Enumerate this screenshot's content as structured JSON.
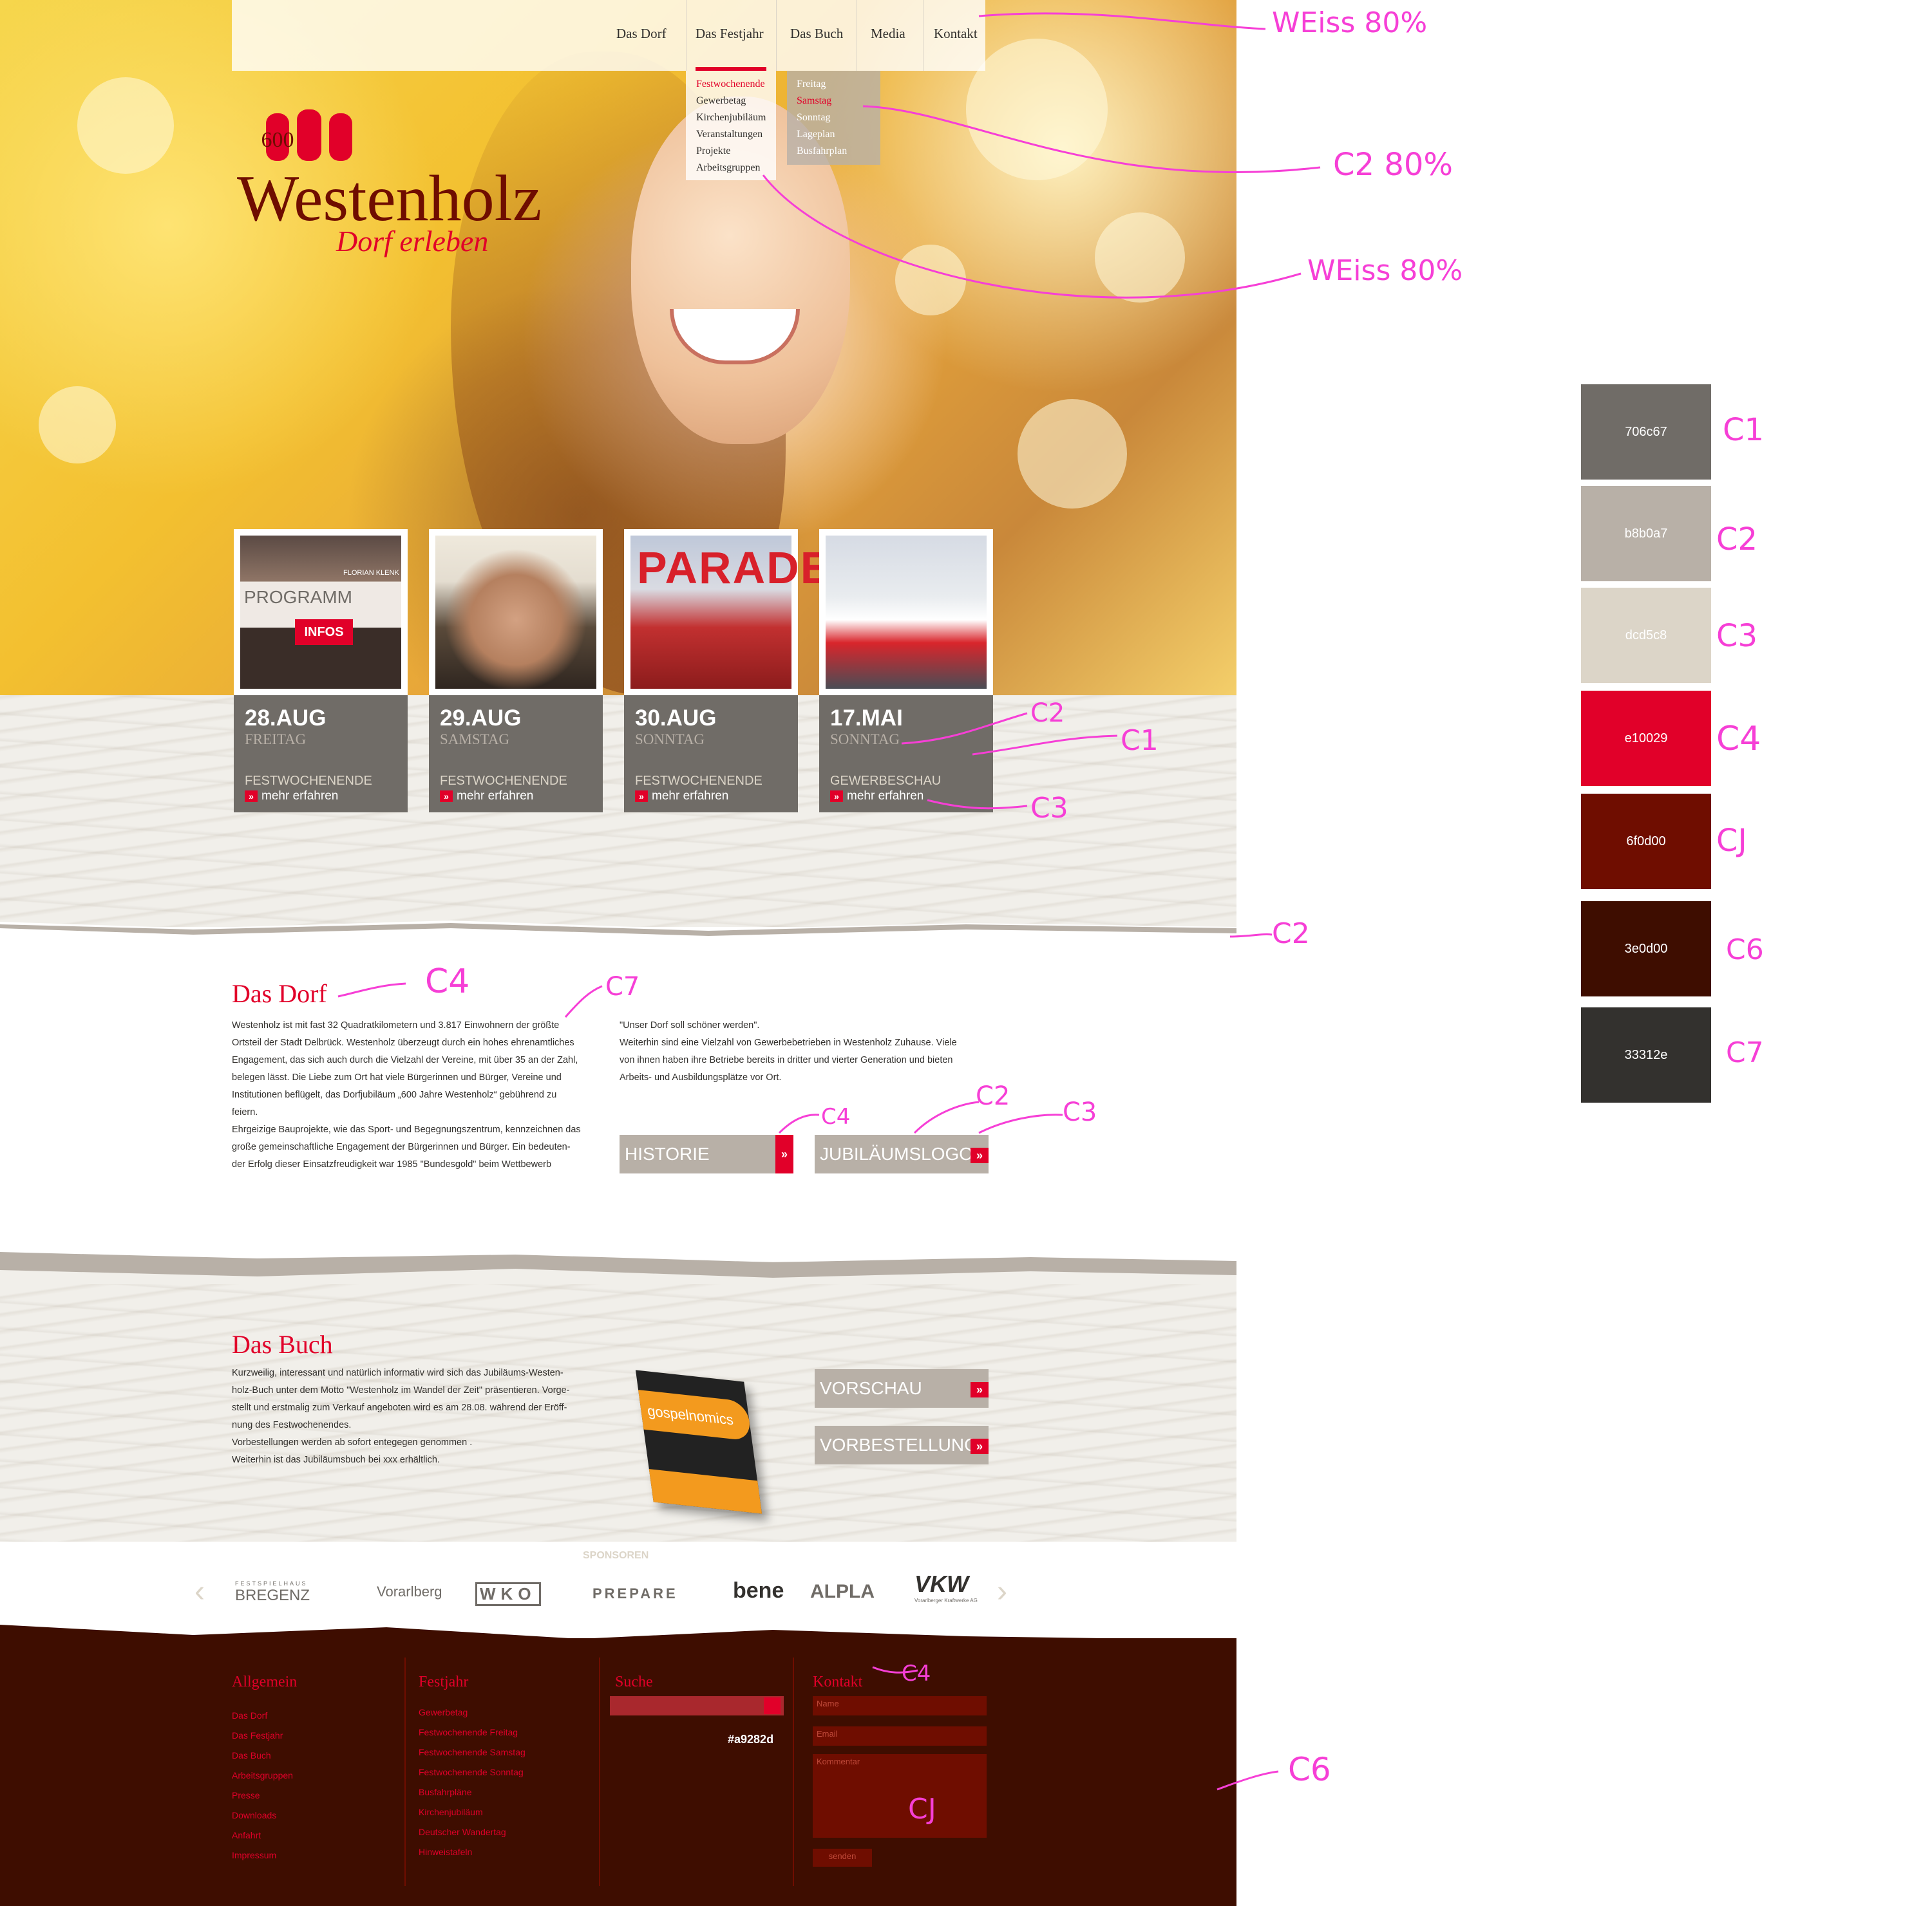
{
  "colors": {
    "c1": "#706c67",
    "c2": "#b8b0a7",
    "c3": "#dcd5c8",
    "c4": "#e10029",
    "c5": "#6f0d00",
    "c6": "#3e0d00",
    "c7": "#33312e",
    "search_field": "#a9282d"
  },
  "nav": {
    "items": [
      "Das Dorf",
      "Das Festjahr",
      "Das Buch",
      "Media",
      "Kontakt"
    ],
    "active": "Das Festjahr",
    "submenu_festjahr": [
      "Festwochenende",
      "Gewerbetag",
      "Kirchenjubiläum",
      "Veranstaltungen",
      "Projekte",
      "Arbeitsgruppen"
    ],
    "submenu_festwochenende": [
      "Freitag",
      "Samstag",
      "Sonntag",
      "Lageplan",
      "Busfahrplan"
    ]
  },
  "logo": {
    "number": "600",
    "title": "Westenholz",
    "subtitle": "Dorf erleben"
  },
  "tiles": [
    {
      "date": "28.AUG",
      "day": "FREITAG",
      "type": "FESTWOCHENENDE",
      "more": "mehr erfahren",
      "programm": "PROGRAMM",
      "infos": "INFOS",
      "book_author": "FLORIAN KLENK"
    },
    {
      "date": "29.AUG",
      "day": "SAMSTAG",
      "type": "FESTWOCHENENDE",
      "more": "mehr erfahren"
    },
    {
      "date": "30.AUG",
      "day": "SONNTAG",
      "type": "FESTWOCHENENDE",
      "more": "mehr erfahren",
      "parade_text": "PARADE"
    },
    {
      "date": "17.MAI",
      "day": "SONNTAG",
      "type": "GEWERBESCHAU",
      "more": "mehr erfahren"
    }
  ],
  "dorf": {
    "title": "Das Dorf",
    "col1_lines": [
      "Westenholz ist mit fast 32 Quadratkilometern und 3.817 Einwohnern der größte",
      "Ortsteil der Stadt Delbrück. Westenholz überzeugt durch ein hohes ehrenamtliches",
      "Engagement, das sich auch durch die Vielzahl der Vereine, mit über 35 an der Zahl,",
      "belegen lässt. Die Liebe zum Ort hat viele Bürgerinnen und Bürger, Vereine und",
      "Institutionen beflügelt, das Dorfjubiläum „600 Jahre Westenholz“ gebührend zu",
      "feiern.",
      "Ehrgeizige Bauprojekte, wie das Sport- und Begegnungszentrum, kennzeichnen das",
      "große gemeinschaftliche Engagement der Bürgerinnen und Bürger. Ein bedeuten-",
      "der Erfolg dieser Einsatzfreudigkeit war 1985 \"Bundesgold\" beim Wettbewerb"
    ],
    "col2_lines": [
      "\"Unser Dorf soll schöner werden\".",
      "Weiterhin sind eine Vielzahl von Gewerbebetrieben in Westenholz Zuhause. Viele",
      "von ihnen haben ihre Betriebe bereits in dritter und vierter Generation und bieten",
      "Arbeits- und Ausbildungsplätze vor Ort."
    ],
    "btn_historie": "HISTORIE",
    "btn_logo": "JUBILÄUMSLOGO"
  },
  "buch": {
    "title": "Das Buch",
    "lines": [
      "Kurzweilig, interessant und natürlich informativ wird sich das Jubiläums-Westen-",
      "holz-Buch unter dem Motto \"Westenholz im Wandel der Zeit\" präsentieren. Vorge-",
      "stellt und erstmalig zum Verkauf angeboten wird es am 28.08. während der Eröff-",
      "nung des Festwochenendes.",
      "Vorbestellungen werden ab sofort entegegen genommen .",
      "Weiterhin ist das Jubiläumsbuch bei xxx erhältlich."
    ],
    "book_title": "gospelnomics",
    "btn_vorschau": "VORSCHAU",
    "btn_vorbestellung": "VORBESTELLUNG"
  },
  "sponsors": {
    "label": "SPONSOREN",
    "logos": [
      "FESTSPIELHAUS",
      "BREGENZ",
      "Vorarlberg",
      "WKO",
      "PREPARE",
      "bene",
      "ALPLA",
      "VKW",
      "Vorarlberger Kraftwerke AG"
    ]
  },
  "footer": {
    "allgemein": {
      "title": "Allgemein",
      "links": [
        "Das Dorf",
        "Das Festjahr",
        "Das Buch",
        "Arbeitsgruppen",
        "Presse",
        "Downloads",
        "Anfahrt",
        "Impressum"
      ]
    },
    "festjahr": {
      "title": "Festjahr",
      "links": [
        "Gewerbetag",
        "Festwochenende Freitag",
        "Festwochenende Samstag",
        "Festwochenende Sonntag",
        "Busfahrpläne",
        "Kirchenjubiläum",
        "Deutscher Wandertag",
        "Hinweistafeln"
      ]
    },
    "suche": {
      "title": "Suche",
      "hex": "#a9282d"
    },
    "kontakt": {
      "title": "Kontakt",
      "name": "Name",
      "email": "Email",
      "kommentar": "Kommentar",
      "send": "senden"
    }
  },
  "annotations": {
    "weiss_top": "WEiss 80%",
    "c2_80": "C2 80%",
    "weiss_sub": "WEiss 80%",
    "c2_tile": "C2",
    "c1_tile": "C1",
    "c3_tile": "C3",
    "c2_wave": "C2",
    "c4_dorf": "C4",
    "c7_text": "C7",
    "c4_btn": "C4",
    "c2_btn": "C2",
    "c3_btn": "C3",
    "c4_footer": "C4",
    "c5_field": "CJ",
    "c6_footer": "C6"
  },
  "swatches": [
    {
      "hex": "706c67",
      "label": "C1",
      "color": "#706c67"
    },
    {
      "hex": "b8b0a7",
      "label": "C2",
      "color": "#b8b0a7"
    },
    {
      "hex": "dcd5c8",
      "label": "C3",
      "color": "#dcd5c8"
    },
    {
      "hex": "e10029",
      "label": "C4",
      "color": "#e10029"
    },
    {
      "hex": "6f0d00",
      "label": "CJ",
      "color": "#6f0d00"
    },
    {
      "hex": "3e0d00",
      "label": "C6",
      "color": "#3e0d00"
    },
    {
      "hex": "33312e",
      "label": "C7",
      "color": "#33312e"
    }
  ]
}
